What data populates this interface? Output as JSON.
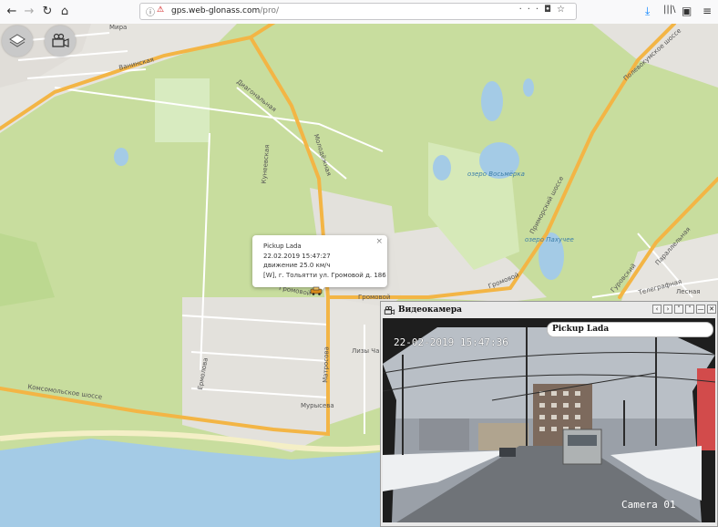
{
  "browser": {
    "url_host": "gps.web-glonass.com",
    "url_path": "/pro/",
    "nav": {
      "back": "←",
      "forward": "→",
      "reload": "↻",
      "home": "⌂"
    },
    "actions": {
      "more": "···",
      "pocket": "◘",
      "bookmark": "☆"
    },
    "right_icons": [
      "download-icon",
      "library-icon",
      "sidebar-icon",
      "menu-icon"
    ]
  },
  "map": {
    "controls": [
      "layers-icon",
      "video-camera-icon"
    ],
    "streets": [
      "Мира",
      "Ванинская",
      "Диагональная",
      "Кунеевская",
      "Молодёжная",
      "Громовой",
      "Громовой",
      "Ермолова",
      "Лизы Чайк",
      "Комсомольское шоссе",
      "Мурысева",
      "Матросова",
      "Полевокумское шоссе",
      "Приморский шоссе",
      "Гуровский",
      "Громовой",
      "Параллельная",
      "Телеграфная",
      "Лесная"
    ],
    "lakes": [
      "озеро Восьмёрка",
      "озеро Пахучее"
    ],
    "colors": {
      "land": "#e8e6e1",
      "green": "#c8dd9e",
      "water": "#a4cbe6",
      "road_major": "#f3b545",
      "road_minor": "#ffffff"
    }
  },
  "popup": {
    "name": "Pickup Lada",
    "datetime": "22.02.2019 15:47:27",
    "status": "движение 25.0 км/ч",
    "address": "[W], г. Тольятти ул. Громовой д. 186",
    "close": "×"
  },
  "video": {
    "title": "Видеокамера",
    "buttons": [
      "‹",
      "›",
      "˅",
      "˄",
      "—",
      "✕"
    ],
    "badge": "Pickup Lada",
    "osd_time": "22-02-2019 15:47:36",
    "osd_camera": "Camera 01"
  }
}
